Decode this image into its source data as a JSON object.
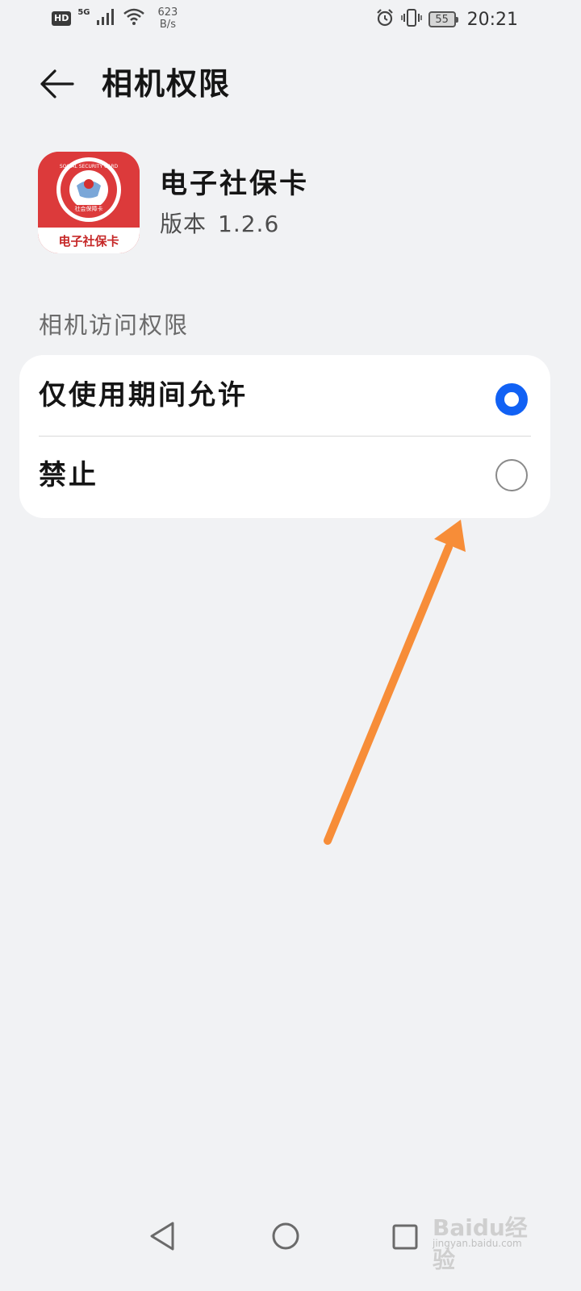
{
  "status_bar": {
    "hd": "HD",
    "network": "5G",
    "speed_value": "623",
    "speed_unit": "B/s",
    "battery": "55",
    "time": "20:21"
  },
  "header": {
    "title": "相机权限"
  },
  "app": {
    "name": "电子社保卡",
    "version_label": "版本",
    "version_number": "1.2.6",
    "icon_ring_text": "SOCIAL SECURITY CARD",
    "icon_banner_text": "社会保障卡",
    "icon_caption": "电子社保卡"
  },
  "section": {
    "label": "相机访问权限"
  },
  "options": [
    {
      "label": "仅使用期间允许",
      "selected": true
    },
    {
      "label": "禁止",
      "selected": false
    }
  ],
  "watermark": {
    "brand": "Baidu经验",
    "url": "jingyan.baidu.com"
  },
  "colors": {
    "accent": "#1161f4",
    "background": "#f1f2f4",
    "card": "#ffffff",
    "arrow": "#f78d38",
    "icon_red": "#dc3a3b"
  }
}
